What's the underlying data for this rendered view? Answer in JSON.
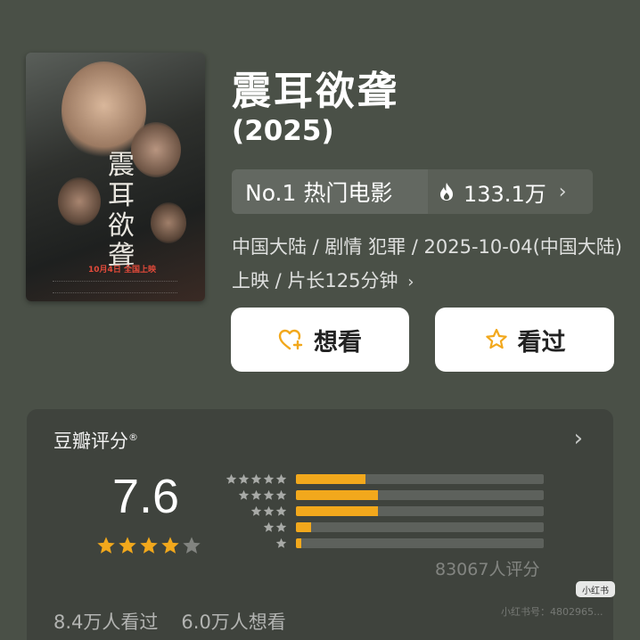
{
  "movie": {
    "title": "震耳欲聋",
    "year": "(2025)",
    "poster": {
      "title_text": "震耳欲聋",
      "release_text": "10月4日 全国上映"
    },
    "rank": {
      "label": "No.1 热门电影",
      "heat": "133.1万",
      "chevron": "›"
    },
    "meta_line": "中国大陆 / 剧情 犯罪 / 2025-10-04(中国大陆)上映 / 片长125分钟",
    "meta_chevron": "›"
  },
  "buttons": {
    "want_label": "想看",
    "seen_label": "看过",
    "want_icon": "heart-plus-icon",
    "seen_icon": "star-outline-icon"
  },
  "rating": {
    "label": "豆瓣评分",
    "registered_mark": "®",
    "chevron": "›",
    "score": "7.6",
    "score_stars_filled": 4,
    "score_stars_total": 5,
    "count_text": "83067人评分",
    "distribution": [
      {
        "stars": 5,
        "fraction": 0.28
      },
      {
        "stars": 4,
        "fraction": 0.33
      },
      {
        "stars": 3,
        "fraction": 0.33
      },
      {
        "stars": 2,
        "fraction": 0.06
      },
      {
        "stars": 1,
        "fraction": 0.02
      }
    ]
  },
  "stats": {
    "seen": "8.4万人看过",
    "want": "6.0万人想看"
  },
  "watermark": {
    "badge": "小红书",
    "id": "小红书号：4802965..."
  },
  "colors": {
    "background": "#4a5047",
    "card": "#3f433d",
    "accent": "#f2a81c",
    "button_bg": "#ffffff"
  }
}
